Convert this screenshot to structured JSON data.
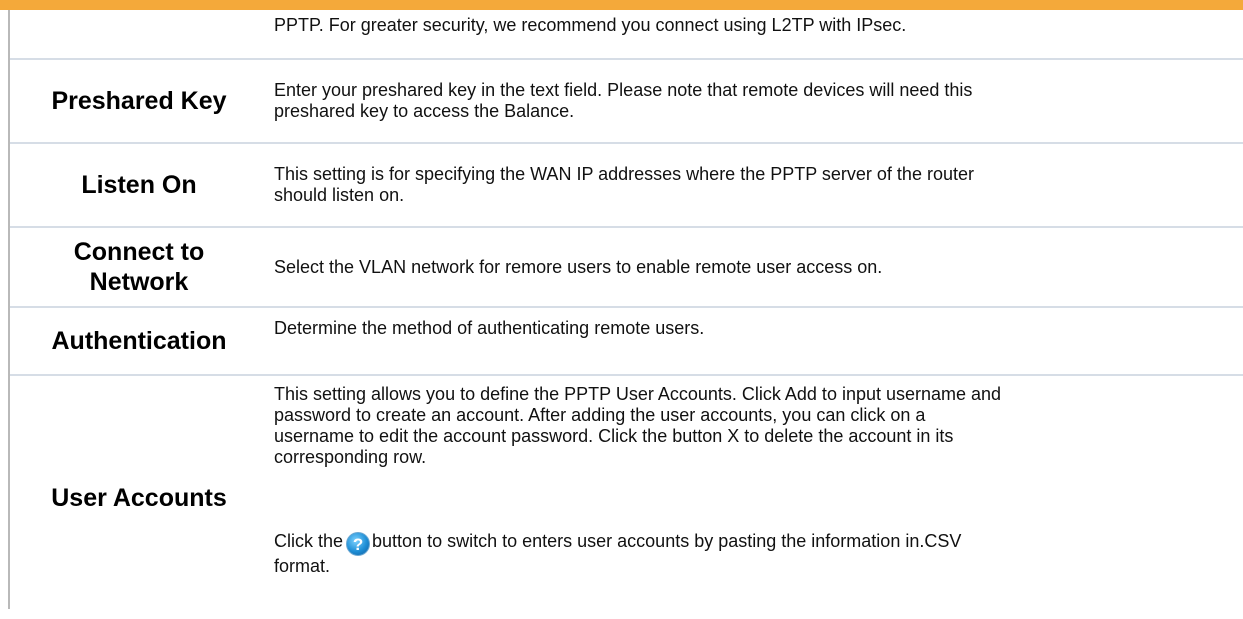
{
  "rows": [
    {
      "label": "",
      "lines": [
        "PPTP. For greater security, we recommend you connect using L2TP with IPsec."
      ]
    },
    {
      "label": "Preshared Key",
      "lines": [
        "Enter your preshared key in the text field. Please note that remote devices will need this",
        "preshared key to access the Balance."
      ]
    },
    {
      "label": "Listen On",
      "lines": [
        "This setting is for specifying the WAN IP addresses where the PPTP server of the router",
        "should listen on."
      ]
    },
    {
      "label_lines": [
        "Connect to",
        "Network"
      ],
      "lines": [
        "Select the VLAN network for remore users to enable remote user access on."
      ]
    },
    {
      "label": "Authentication",
      "lines": [
        "Determine the method of authenticating remote users."
      ]
    },
    {
      "label": "User Accounts",
      "lines": [
        "This setting allows you to define the PPTP User Accounts. Click Add to input username and",
        "password to create an account. After adding the user accounts, you can click on a",
        "username to edit the account password. Click the button X to delete the account in its",
        "corresponding row."
      ],
      "help_line_before": "Click the",
      "help_icon": "help-question-icon",
      "help_line_after": "button to switch to enters user accounts by pasting the information in.CSV",
      "help_line_2": "format."
    }
  ],
  "colors": {
    "top_bar": "#f4a93a",
    "row_divider": "#d6dde6"
  }
}
